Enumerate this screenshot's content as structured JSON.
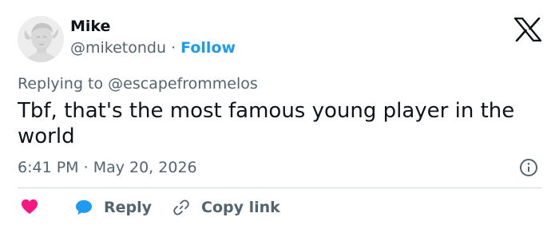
{
  "author": {
    "name": "Mike",
    "handle": "@miketondu",
    "separator": " · ",
    "follow_label": "Follow",
    "avatar": "statue-head-avatar"
  },
  "brand": {
    "logo": "x-logo-icon",
    "color": "#0f1419"
  },
  "reply_context": {
    "prefix": "Replying to ",
    "mention": "@escapefrommelos"
  },
  "tweet": {
    "text": "Tbf, that's the most famous young player in the world"
  },
  "meta": {
    "time": "6:41 PM",
    "separator": " · ",
    "date": "May 20, 2026",
    "info_icon": "info-icon"
  },
  "actions": {
    "like_icon": "heart-icon",
    "reply_label": "Reply",
    "reply_icon": "chat-bubble-icon",
    "copy_label": "Copy link",
    "copy_icon": "link-icon"
  },
  "colors": {
    "accent": "#1d9bf0",
    "heart": "#f91880",
    "muted": "#536471",
    "divider": "#cfd9de",
    "text": "#0f1419"
  }
}
